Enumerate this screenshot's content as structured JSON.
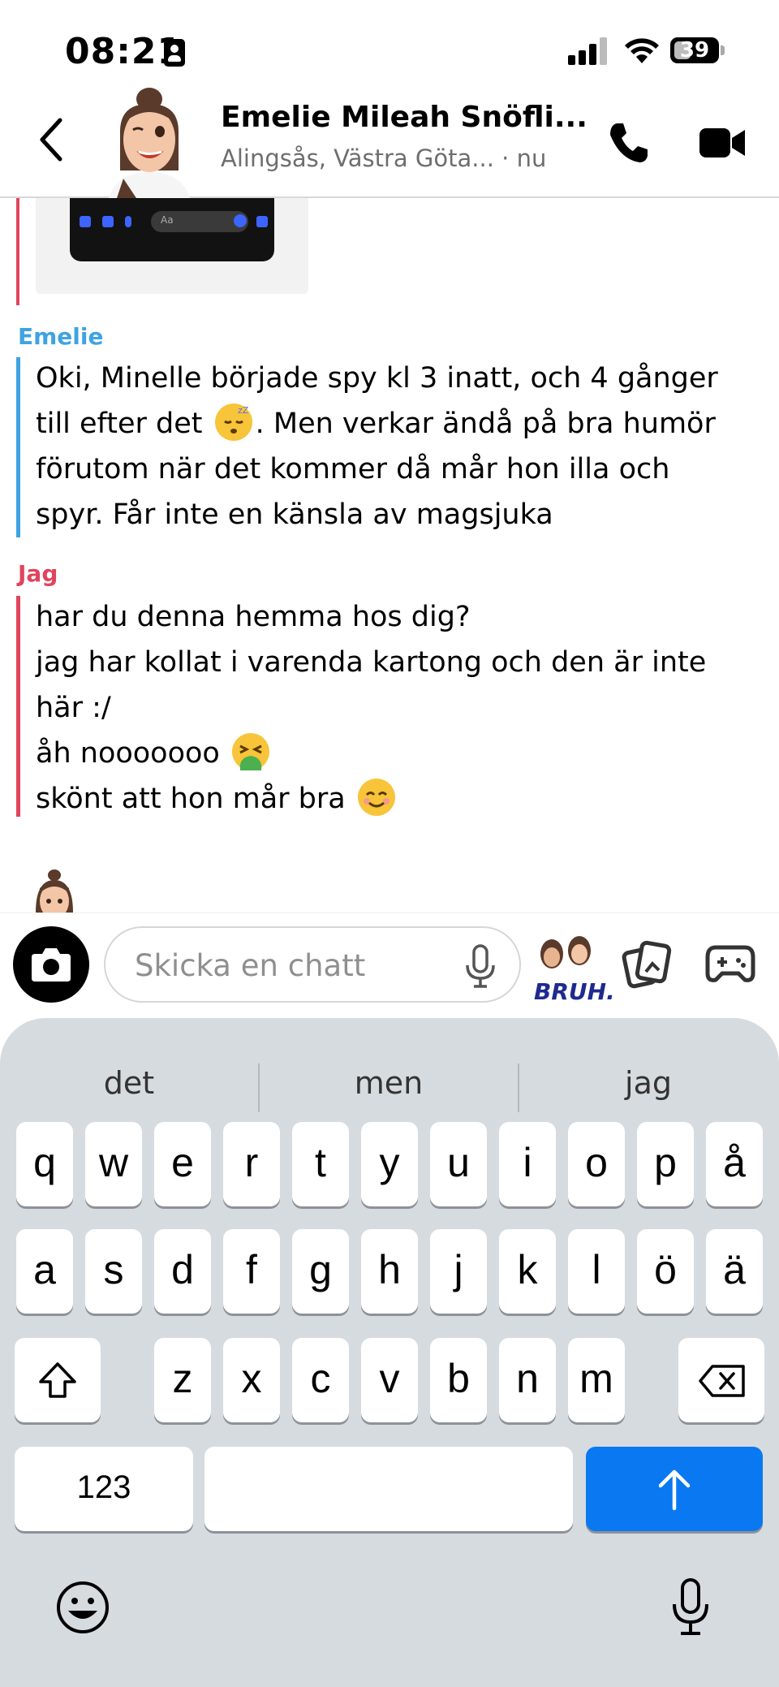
{
  "status_bar": {
    "time": "08:21",
    "battery": "39",
    "battery_level": 0.39
  },
  "header": {
    "contact_name": "Emelie Mileah Snöfli...",
    "location": "Alingsås, Västra Göta... · nu"
  },
  "messages": [
    {
      "sender": "Emelie",
      "lines": [
        "Oki, Minelle började spy kl 3 inatt, och 4 gånger",
        "till efter det ",
        ". Men verkar ändå på bra humör",
        "förutom när det kommer då mår hon illa och",
        "spyr. Får inte en känsla av magsjuka"
      ]
    },
    {
      "sender": "Jag",
      "lines": [
        "har du denna hemma hos dig?",
        "jag har kollat i varenda kartong och den är inte",
        "här :/",
        "åh nooooooo ",
        "skönt att hon mår bra "
      ]
    }
  ],
  "screenshot_input_placeholder": "Aa",
  "composer": {
    "placeholder": "Skicka en chatt",
    "sticker_text": "BRUH."
  },
  "keyboard": {
    "suggestions": [
      "det",
      "men",
      "jag"
    ],
    "row1": [
      "q",
      "w",
      "e",
      "r",
      "t",
      "y",
      "u",
      "i",
      "o",
      "p",
      "å"
    ],
    "row2": [
      "a",
      "s",
      "d",
      "f",
      "g",
      "h",
      "j",
      "k",
      "l",
      "ö",
      "ä"
    ],
    "row3": [
      "z",
      "x",
      "c",
      "v",
      "b",
      "n",
      "m"
    ],
    "numbers_key": "123"
  },
  "colors": {
    "friend_accent": "#3fa3e2",
    "self_accent": "#e0445c",
    "return_key": "#0a78f0",
    "keyboard_bg": "#d6dbe0"
  },
  "icons": [
    "back-arrow-icon",
    "phone-icon",
    "video-icon",
    "camera-icon",
    "mic-icon",
    "memories-icon",
    "games-icon",
    "shift-icon",
    "backspace-icon",
    "emoji-icon",
    "dictation-mic-icon",
    "return-arrow-icon"
  ]
}
